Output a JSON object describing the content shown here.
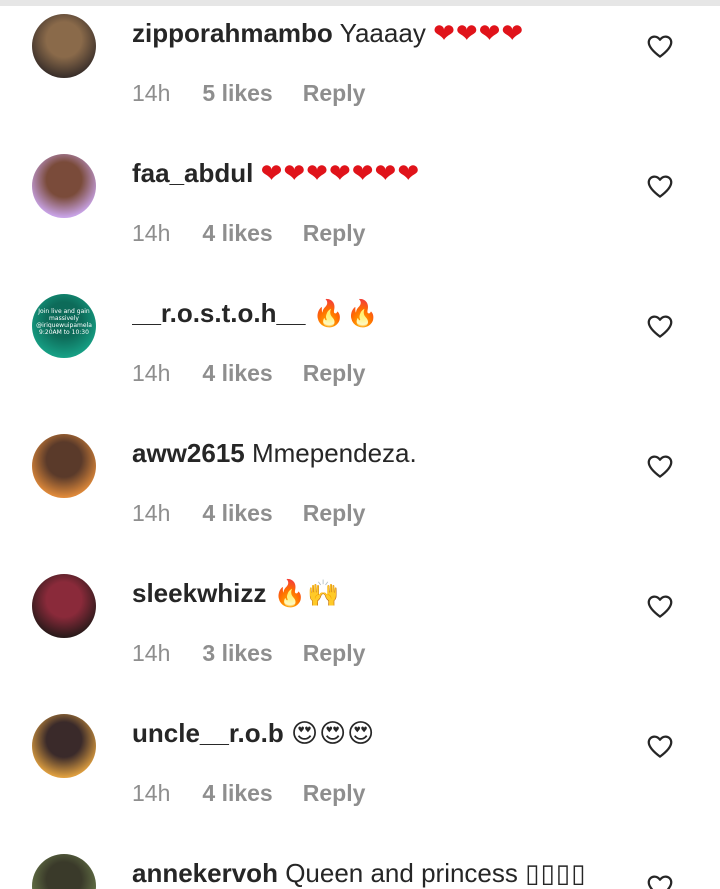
{
  "comments": [
    {
      "username": "zipporahmambo",
      "text": "Yaaaay",
      "emoji": "❤❤❤❤",
      "emoji_kind": "heart",
      "time": "14h",
      "likes": "5 likes",
      "reply": "Reply",
      "avatar_colors": [
        "#3a2f2a",
        "#8a6a4a"
      ]
    },
    {
      "username": "faa_abdul",
      "text": "",
      "emoji": "❤❤❤❤❤❤❤",
      "emoji_kind": "heart",
      "time": "14h",
      "likes": "4 likes",
      "reply": "Reply",
      "avatar_colors": [
        "#c9a4e8",
        "#7a4b3a"
      ]
    },
    {
      "username": "__r.o.s.t.o.h__",
      "text": "",
      "emoji": "🔥🔥",
      "emoji_kind": "fire",
      "time": "14h",
      "likes": "4 likes",
      "reply": "Reply",
      "avatar_colors": [
        "#17a085",
        "#0d6b59"
      ]
    },
    {
      "username": "aww2615",
      "text": "Mmependeza.",
      "emoji": "",
      "emoji_kind": "none",
      "time": "14h",
      "likes": "4 likes",
      "reply": "Reply",
      "avatar_colors": [
        "#e08a3a",
        "#5a3a2a"
      ]
    },
    {
      "username": "sleekwhizz",
      "text": "",
      "emoji": "🔥🙌",
      "emoji_kind": "fire",
      "time": "14h",
      "likes": "3 likes",
      "reply": "Reply",
      "avatar_colors": [
        "#2a1a1a",
        "#8a2a3a"
      ]
    },
    {
      "username": "uncle__r.o.b",
      "text": "",
      "emoji": "😍😍😍",
      "emoji_kind": "face",
      "time": "14h",
      "likes": "4 likes",
      "reply": "Reply",
      "avatar_colors": [
        "#e0a040",
        "#3a2a2a"
      ]
    },
    {
      "username": "annekervoh",
      "text": "Queen and princess",
      "emoji": "▯▯▯▯",
      "emoji_kind": "box",
      "time": "",
      "likes": "",
      "reply": "",
      "avatar_colors": [
        "#6a7a4a",
        "#3a3a2a"
      ]
    }
  ],
  "avatar_promo_text": "Join live and gain massively @iriquewuipamela 9:20AM to 10:30",
  "colors": {
    "text_primary": "#262626",
    "text_secondary": "#8e8e8e",
    "heart_red": "#e0131a",
    "background": "#ffffff"
  },
  "icons": {
    "like": "heart-outline-icon"
  }
}
